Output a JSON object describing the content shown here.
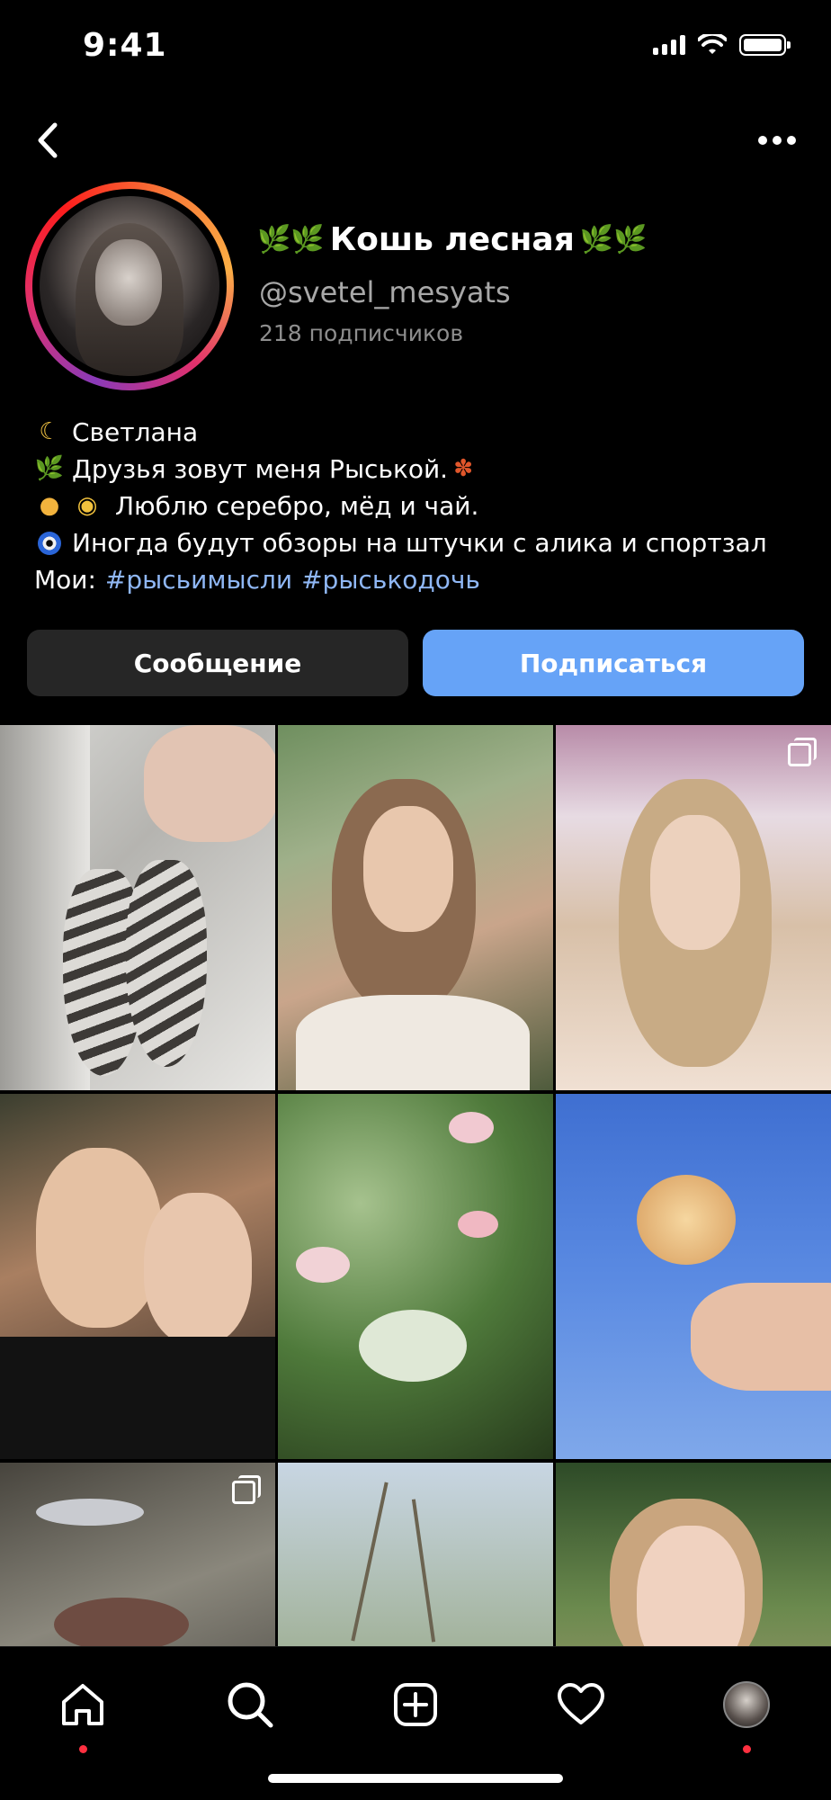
{
  "status_bar": {
    "time": "9:41"
  },
  "profile": {
    "display_name": "Кошь лесная",
    "username": "@svetel_mesyats",
    "followers": "218 подписчиков"
  },
  "bio": {
    "line1": "Светлана",
    "line2": "Друзья зовут меня Рыськой.",
    "line3": "Люблю серебро, мёд и чай.",
    "line4": "Иногда будут обзоры на штучки с алика и спортзал",
    "line5_prefix": "Мои:",
    "hashtags": [
      "#рысьимысли",
      "#рыськодочь"
    ]
  },
  "actions": {
    "message_label": "Сообщение",
    "follow_label": "Подписаться"
  },
  "colors": {
    "accent": "#66a3f7",
    "hashtag": "#8fb7f5",
    "notification": "#ff3040"
  },
  "grid": {
    "tiles": [
      {
        "icon": "feather-earrings",
        "multi": false
      },
      {
        "icon": "portrait-outdoor",
        "multi": false
      },
      {
        "icon": "selfie-mall",
        "multi": true
      },
      {
        "icon": "selfie-two-people",
        "multi": false
      },
      {
        "icon": "water-lilies",
        "multi": false
      },
      {
        "icon": "rose-sky",
        "multi": false
      },
      {
        "icon": "mushroom-tree",
        "multi": true
      },
      {
        "icon": "grass-sky",
        "multi": false
      },
      {
        "icon": "selfie-park",
        "multi": false
      }
    ]
  },
  "tab_bar": {
    "items": [
      "home-icon",
      "search-icon",
      "add-post-icon",
      "heart-icon",
      "profile-avatar"
    ]
  }
}
